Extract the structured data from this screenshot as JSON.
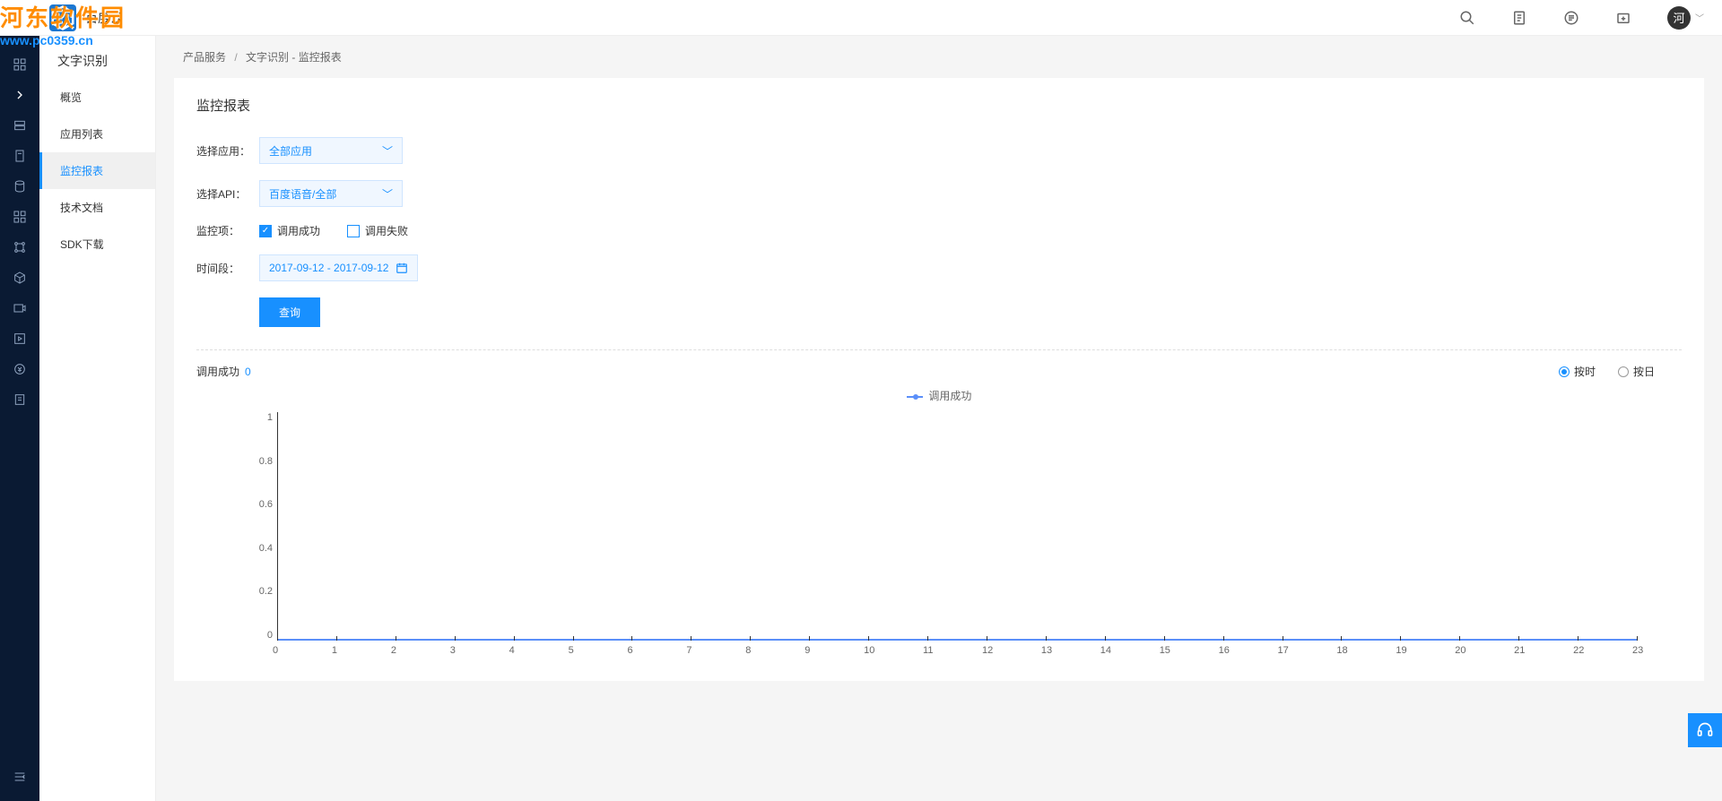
{
  "watermark": {
    "line1": "河东软件园",
    "line2": "www.pc0359.cn"
  },
  "topbar": {
    "title": "百度云",
    "avatar": "河"
  },
  "sidebar": {
    "title": "文字识别",
    "items": [
      {
        "label": "概览"
      },
      {
        "label": "应用列表"
      },
      {
        "label": "监控报表"
      },
      {
        "label": "技术文档"
      },
      {
        "label": "SDK下载"
      }
    ]
  },
  "breadcrumb": {
    "a": "产品服务",
    "b": "文字识别 - 监控报表"
  },
  "card": {
    "title": "监控报表",
    "labels": {
      "app": "选择应用：",
      "api": "选择API：",
      "metrics": "监控项：",
      "period": "时间段："
    },
    "app_select": "全部应用",
    "api_select": "百度语音/全部",
    "cb_success": "调用成功",
    "cb_fail": "调用失败",
    "date_range": "2017-09-12 - 2017-09-12",
    "query_btn": "查询"
  },
  "chart_ui": {
    "title": "调用成功",
    "count": "0",
    "radio_hour": "按时",
    "radio_day": "按日",
    "legend": "调用成功"
  },
  "chart_data": {
    "type": "line",
    "title": "调用成功",
    "xlabel": "",
    "ylabel": "",
    "ylim": [
      0,
      1
    ],
    "y_ticks": [
      "1",
      "0.8",
      "0.6",
      "0.4",
      "0.2",
      "0"
    ],
    "x": [
      0,
      1,
      2,
      3,
      4,
      5,
      6,
      7,
      8,
      9,
      10,
      11,
      12,
      13,
      14,
      15,
      16,
      17,
      18,
      19,
      20,
      21,
      22,
      23
    ],
    "series": [
      {
        "name": "调用成功",
        "values": [
          0,
          0,
          0,
          0,
          0,
          0,
          0,
          0,
          0,
          0,
          0,
          0,
          0,
          0,
          0,
          0,
          0,
          0,
          0,
          0,
          0,
          0,
          0,
          0
        ]
      }
    ]
  }
}
